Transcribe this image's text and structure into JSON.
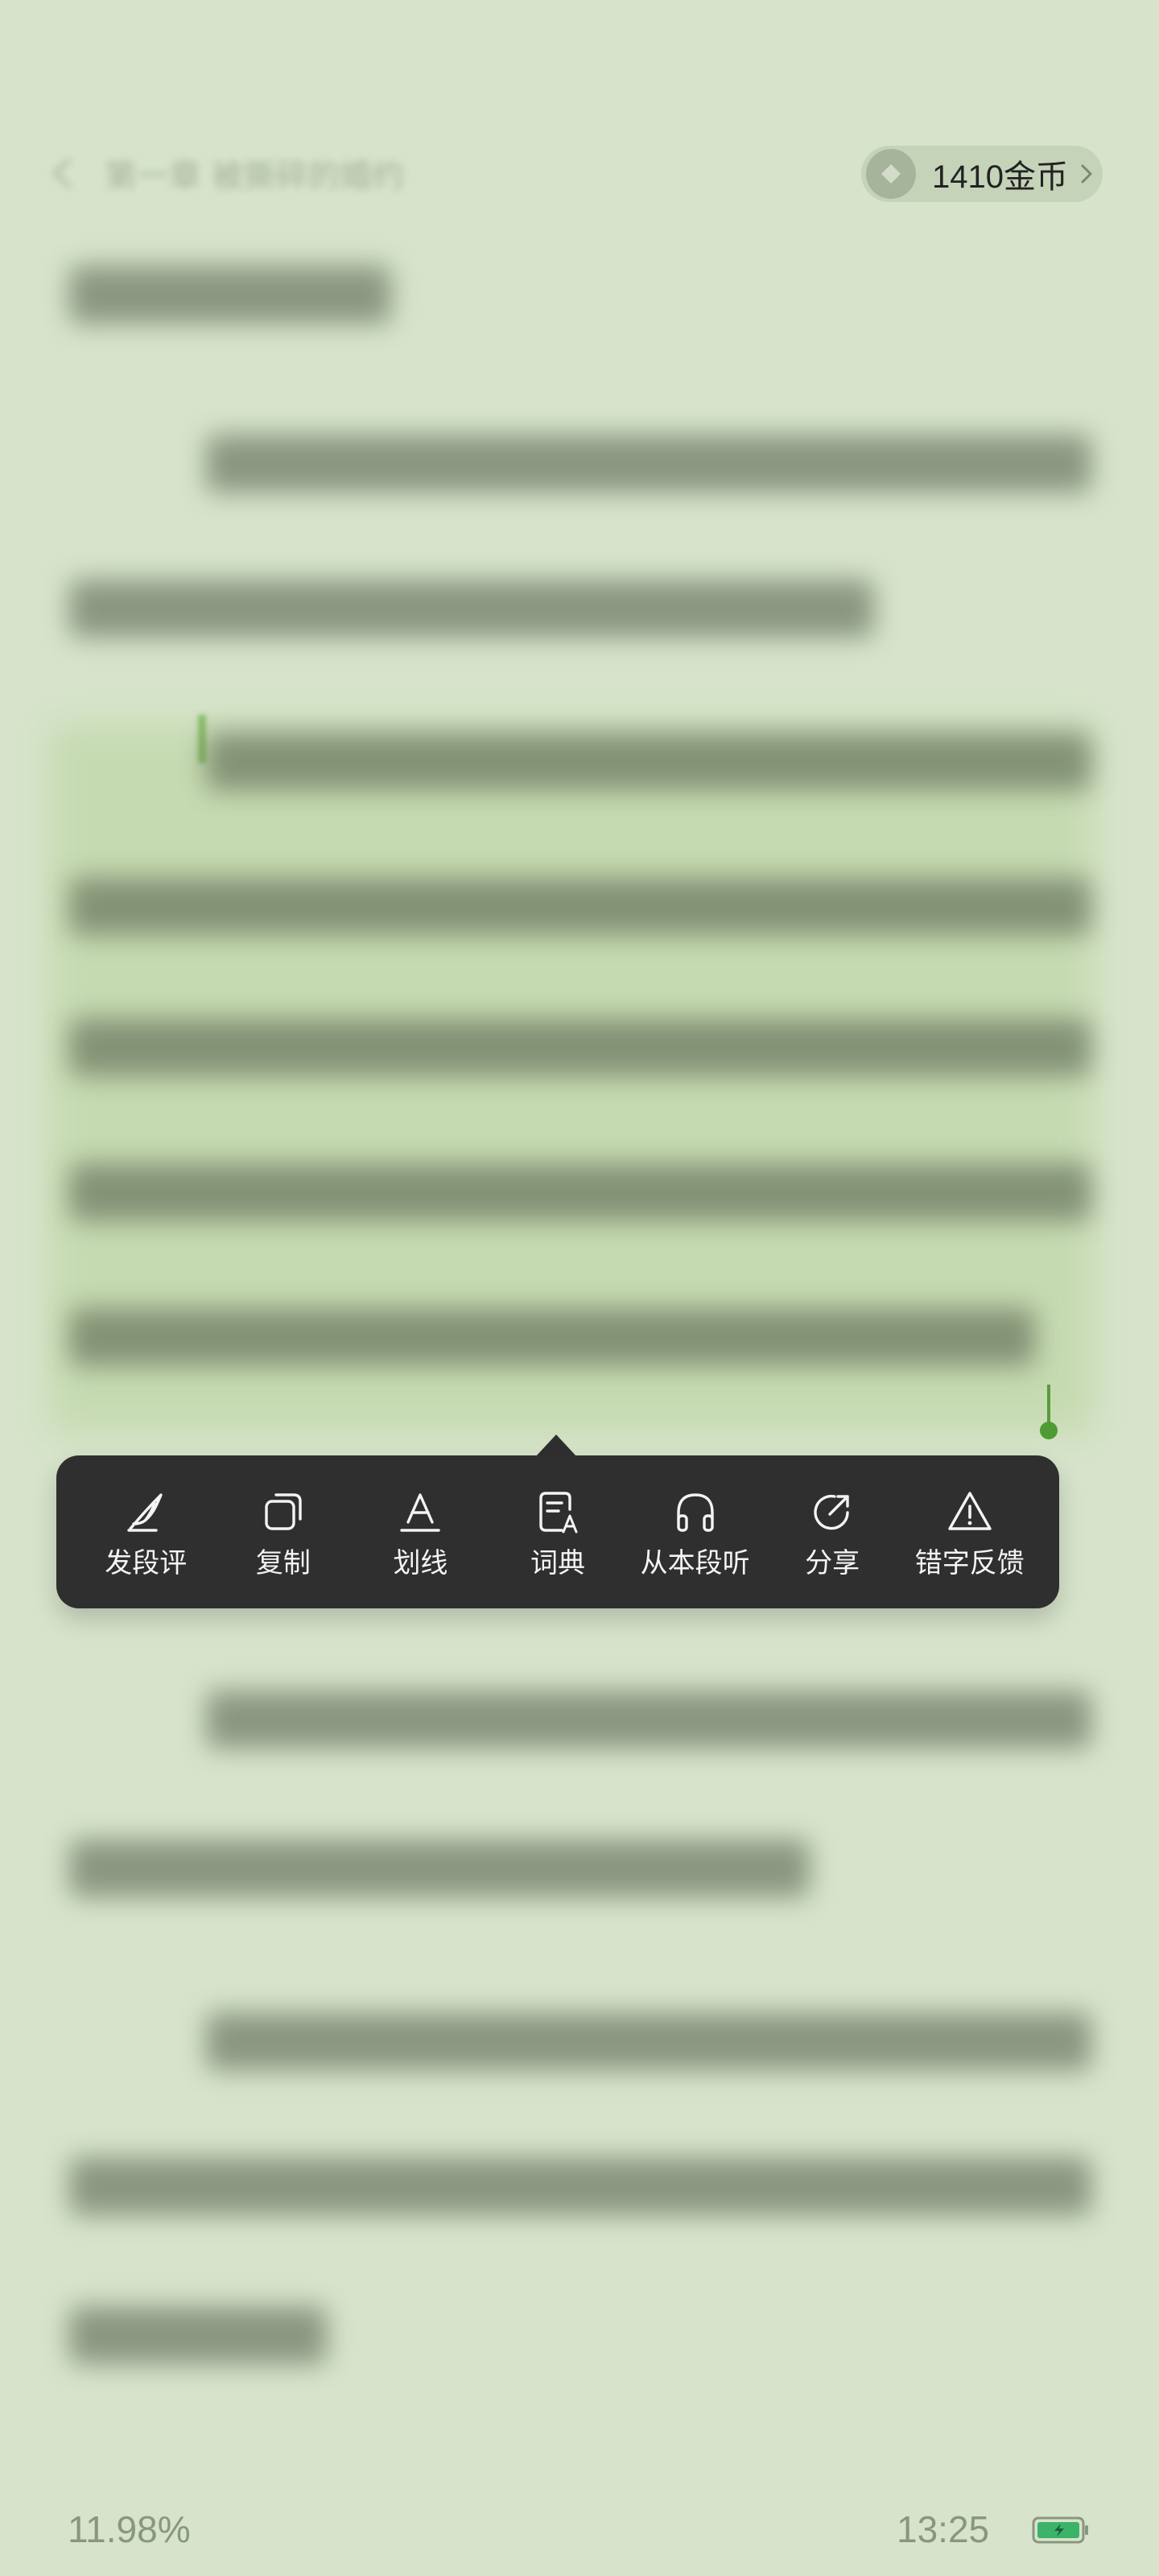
{
  "header": {
    "chapter_title": "第一章 被撕碎的婚约",
    "coins": {
      "label": "1410金币",
      "icon": "diamond-coin-icon"
    }
  },
  "selection_menu": {
    "items": [
      {
        "label": "发段评",
        "icon": "feather-quill-icon"
      },
      {
        "label": "复制",
        "icon": "copy-icon"
      },
      {
        "label": "划线",
        "icon": "underline-a-icon"
      },
      {
        "label": "词典",
        "icon": "dictionary-icon"
      },
      {
        "label": "从本段听",
        "icon": "headphones-icon"
      },
      {
        "label": "分享",
        "icon": "share-icon"
      },
      {
        "label": "错字反馈",
        "icon": "warning-icon"
      }
    ]
  },
  "footer": {
    "progress": "11.98%",
    "time": "13:25",
    "battery_icon": "battery-charging-icon"
  },
  "colors": {
    "background": "#d7e4cb",
    "menu_background": "#2f2f2f",
    "selection_accent": "#4f9b33",
    "highlight": "#c2d9ac"
  }
}
